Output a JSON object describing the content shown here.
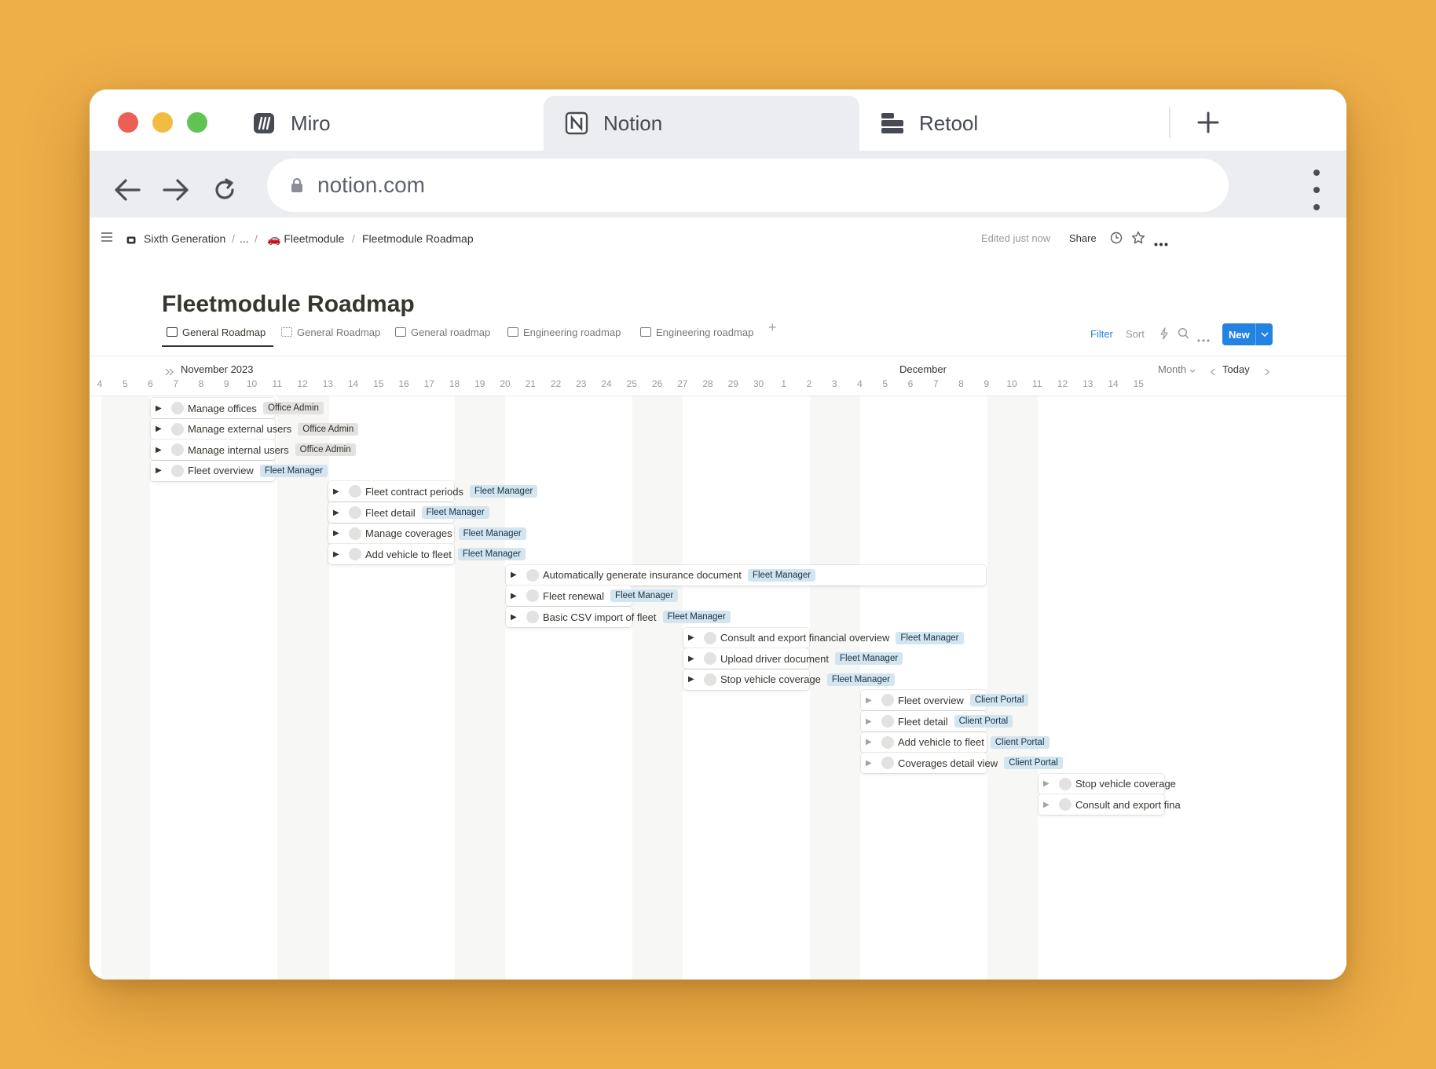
{
  "browser": {
    "tabs": [
      {
        "label": "Miro",
        "icon": "miro-icon",
        "active": false
      },
      {
        "label": "Notion",
        "icon": "notion-icon",
        "active": true
      },
      {
        "label": "Retool",
        "icon": "retool-icon",
        "active": false
      }
    ],
    "url": "notion.com"
  },
  "notion": {
    "breadcrumb": {
      "workspace": "Sixth Generation",
      "ellipsis": "...",
      "parent": "🚗 Fleetmodule",
      "current": "Fleetmodule Roadmap",
      "separator": "/"
    },
    "topbar": {
      "edited": "Edited just now",
      "share": "Share"
    },
    "title": "Fleetmodule Roadmap",
    "views": [
      {
        "label": "General Roadmap",
        "icon": "timeline-icon",
        "active": true
      },
      {
        "label": "General Roadmap",
        "icon": "gallery-icon",
        "active": false
      },
      {
        "label": "General roadmap",
        "icon": "table-icon",
        "active": false
      },
      {
        "label": "Engineering roadmap",
        "icon": "board-icon",
        "active": false
      },
      {
        "label": "Engineering roadmap",
        "icon": "table-icon",
        "active": false
      }
    ],
    "toolbar": {
      "filter": "Filter",
      "sort": "Sort",
      "new": "New"
    },
    "timeline": {
      "month_left": "November 2023",
      "month_right": "December",
      "scale": "Month",
      "today": "Today",
      "days": [
        "4",
        "5",
        "6",
        "7",
        "8",
        "9",
        "10",
        "11",
        "12",
        "13",
        "14",
        "15",
        "16",
        "17",
        "18",
        "19",
        "20",
        "21",
        "22",
        "23",
        "24",
        "25",
        "26",
        "27",
        "28",
        "29",
        "30",
        "1",
        "2",
        "3",
        "4",
        "5",
        "6",
        "7",
        "8",
        "9",
        "10",
        "11",
        "12",
        "13",
        "14",
        "15"
      ],
      "tasks": [
        {
          "name": "Manage offices",
          "tag": "Office Admin",
          "tag_color": "grey"
        },
        {
          "name": "Manage external users",
          "tag": "Office Admin",
          "tag_color": "grey"
        },
        {
          "name": "Manage internal users",
          "tag": "Office Admin",
          "tag_color": "grey"
        },
        {
          "name": "Fleet overview",
          "tag": "Fleet Manager",
          "tag_color": "blue"
        },
        {
          "name": "Fleet contract periods",
          "tag": "Fleet Manager",
          "tag_color": "blue"
        },
        {
          "name": "Fleet detail",
          "tag": "Fleet Manager",
          "tag_color": "blue"
        },
        {
          "name": "Manage coverages",
          "tag": "Fleet Manager",
          "tag_color": "blue"
        },
        {
          "name": "Add vehicle to fleet",
          "tag": "Fleet Manager",
          "tag_color": "blue"
        },
        {
          "name": "Automatically generate insurance document",
          "tag": "Fleet Manager",
          "tag_color": "blue"
        },
        {
          "name": "Fleet renewal",
          "tag": "Fleet Manager",
          "tag_color": "blue"
        },
        {
          "name": "Basic CSV import of fleet",
          "tag": "Fleet Manager",
          "tag_color": "blue"
        },
        {
          "name": "Consult and export financial overview",
          "tag": "Fleet Manager",
          "tag_color": "blue"
        },
        {
          "name": "Upload driver document",
          "tag": "Fleet Manager",
          "tag_color": "blue"
        },
        {
          "name": "Stop vehicle coverage",
          "tag": "Fleet Manager",
          "tag_color": "blue"
        },
        {
          "name": "Fleet overview",
          "tag": "Client Portal",
          "tag_color": "blue"
        },
        {
          "name": "Fleet detail",
          "tag": "Client Portal",
          "tag_color": "blue"
        },
        {
          "name": "Add vehicle to fleet",
          "tag": "Client Portal",
          "tag_color": "blue"
        },
        {
          "name": "Coverages detail view",
          "tag": "Client Portal",
          "tag_color": "blue"
        },
        {
          "name": "Stop vehicle coverage",
          "tag": "",
          "tag_color": "blue"
        },
        {
          "name": "Consult and export fina",
          "tag": "",
          "tag_color": "blue"
        }
      ]
    }
  }
}
